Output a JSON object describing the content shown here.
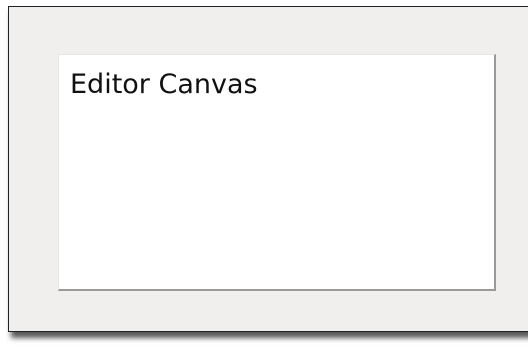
{
  "editor": {
    "canvas_text": "Editor Canvas"
  }
}
